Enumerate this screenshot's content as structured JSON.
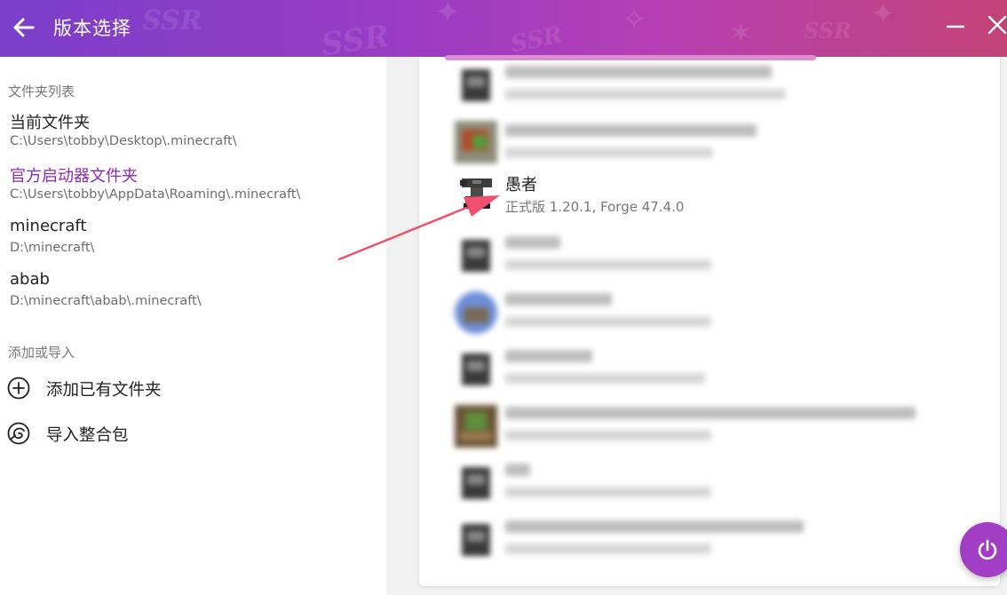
{
  "window": {
    "title": "版本选择",
    "watermark": "SSR",
    "icons": {
      "back": "arrow-left-icon",
      "minimize": "minus-icon",
      "close": "close-x-icon"
    }
  },
  "sidebar": {
    "folders_header": "文件夹列表",
    "folders": [
      {
        "name": "当前文件夹",
        "path": "C:\\Users\\tobby\\Desktop\\.minecraft\\",
        "active": false
      },
      {
        "name": "官方启动器文件夹",
        "path": "C:\\Users\\tobby\\AppData\\Roaming\\.minecraft\\",
        "active": true
      },
      {
        "name": "minecraft",
        "path": "D:\\minecraft\\",
        "active": false
      },
      {
        "name": "abab",
        "path": "D:\\minecraft\\abab\\.minecraft\\",
        "active": false
      }
    ],
    "actions_header": "添加或导入",
    "actions": [
      {
        "label": "添加已有文件夹",
        "icon": "plus-circle-icon"
      },
      {
        "label": "导入整合包",
        "icon": "modpack-import-icon"
      }
    ]
  },
  "versions": [
    {
      "name": "",
      "desc": "",
      "icon": "furnace-icon",
      "blurred": true
    },
    {
      "name": "",
      "desc": "",
      "icon": "modpack-thumbnail-icon",
      "blurred": true
    },
    {
      "name": "愚者",
      "desc": "正式版 1.20.1, Forge 47.4.0",
      "icon": "anvil-icon",
      "blurred": false
    },
    {
      "name": "",
      "desc": "",
      "icon": "furnace-icon",
      "blurred": true
    },
    {
      "name": "",
      "desc": "",
      "icon": "modpack-thumbnail-icon",
      "blurred": true
    },
    {
      "name": "",
      "desc": "",
      "icon": "furnace-icon",
      "blurred": true
    },
    {
      "name": "",
      "desc": "",
      "icon": "modpack-thumbnail-icon",
      "blurred": true
    },
    {
      "name": "",
      "desc": "",
      "icon": "furnace-icon",
      "blurred": true
    },
    {
      "name": "",
      "desc": "",
      "icon": "furnace-icon",
      "blurred": true
    }
  ],
  "launch_button": {
    "icon": "power-icon"
  },
  "colors": {
    "accent": "#8a2ab0",
    "titlebar_start": "#7a3fc9",
    "titlebar_end": "#c24377",
    "fab": "#a23ec4",
    "annotation_arrow": "#f0506e"
  }
}
